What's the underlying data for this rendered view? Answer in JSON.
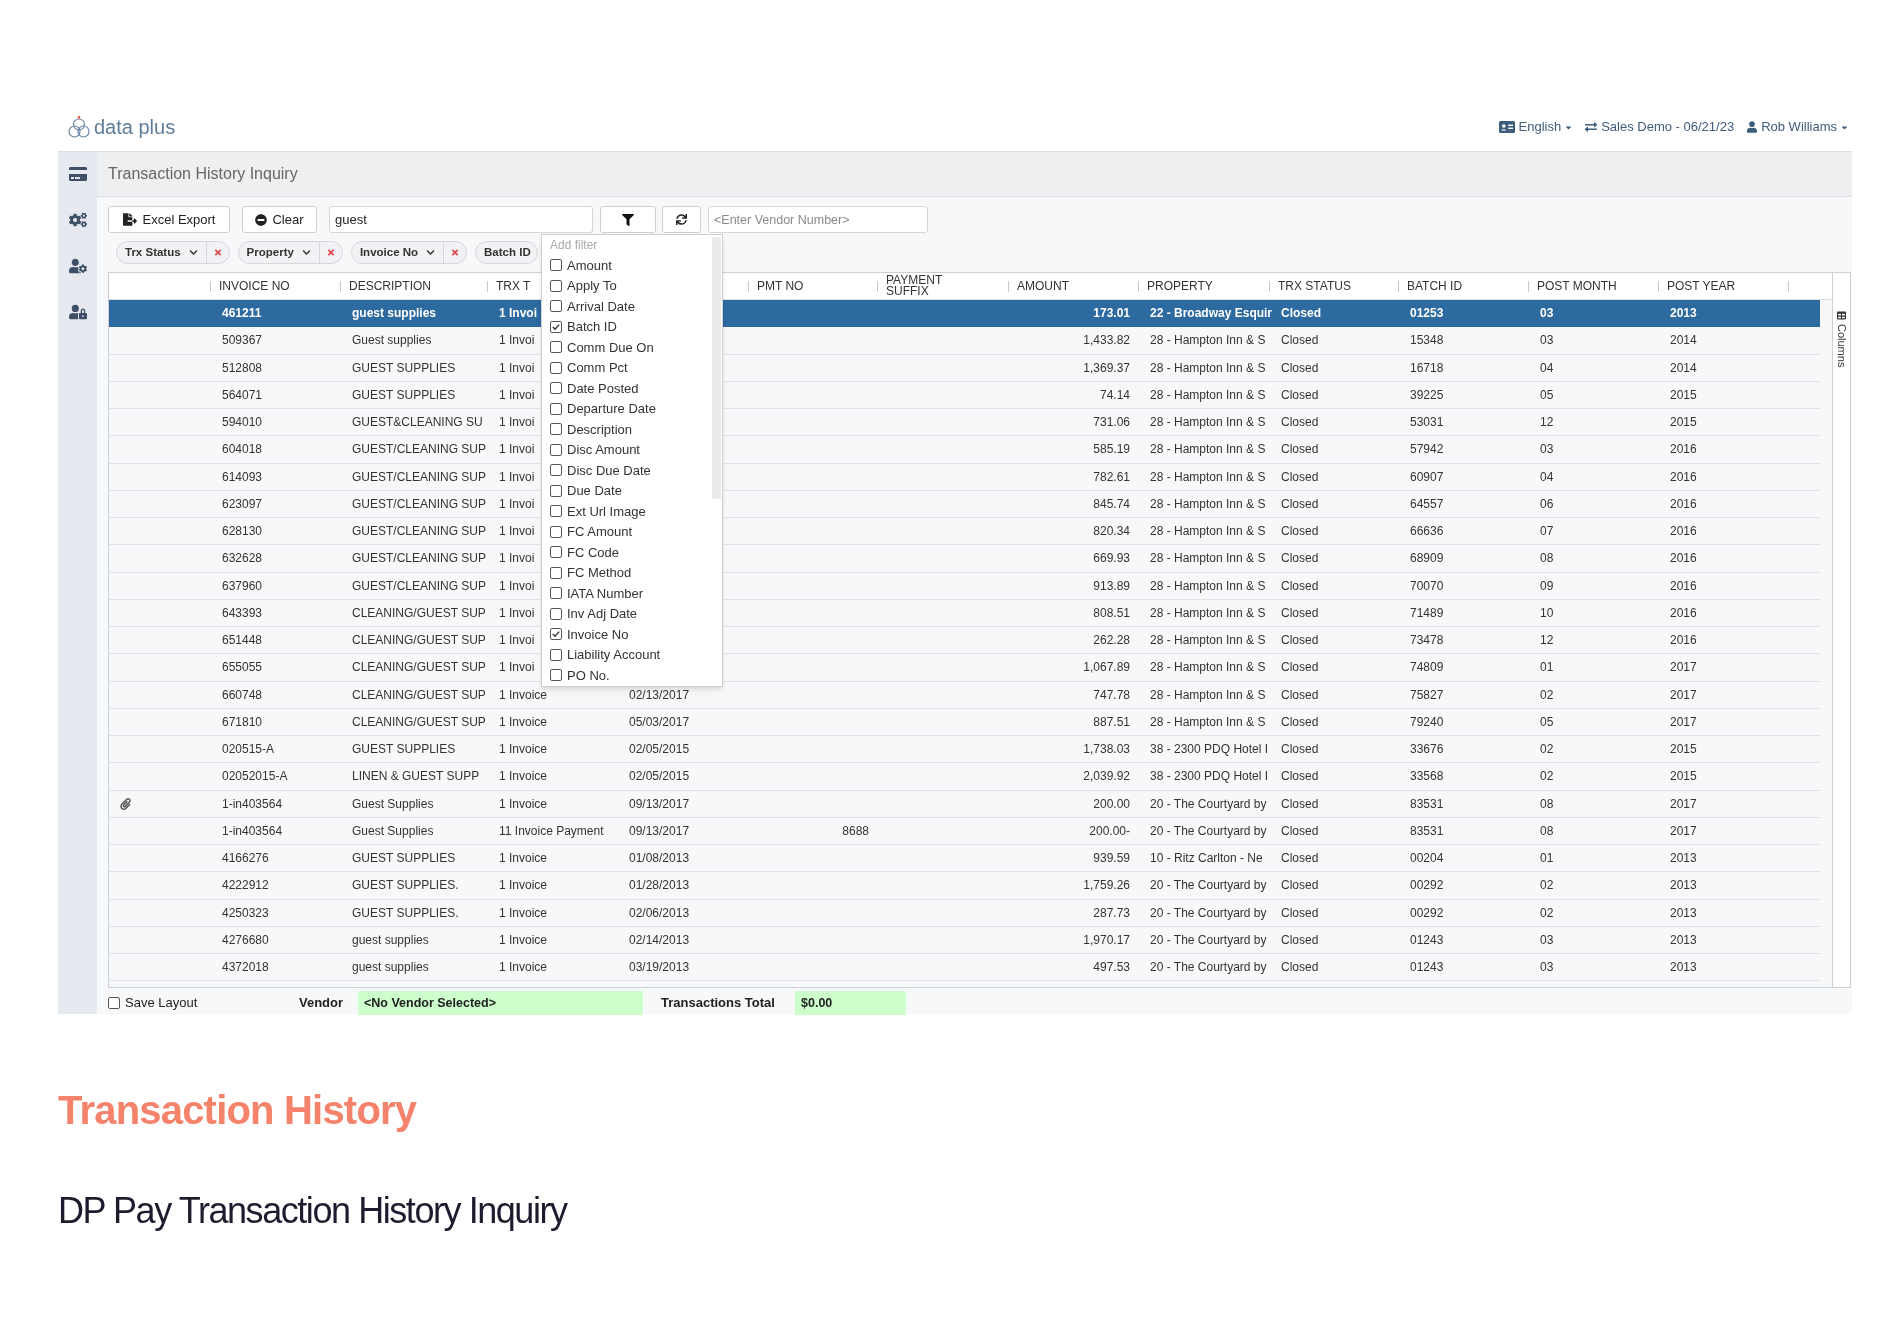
{
  "header": {
    "logo": "data plus",
    "language": "English",
    "session": "Sales Demo - 06/21/23",
    "user": "Rob Williams"
  },
  "page": {
    "title": "Transaction History Inquiry"
  },
  "toolbar": {
    "excel_export": "Excel Export",
    "clear": "Clear",
    "search": {
      "value": "guest"
    },
    "vendor_number": {
      "placeholder": "<Enter Vendor Number>"
    }
  },
  "filter_chips": [
    {
      "label": "Trx Status",
      "removable": true
    },
    {
      "label": "Property",
      "removable": true
    },
    {
      "label": "Invoice No",
      "removable": true
    },
    {
      "label": "Batch ID",
      "removable": false
    }
  ],
  "filter_menu": {
    "placeholder": "Add filter",
    "options": [
      {
        "label": "Amount",
        "checked": false
      },
      {
        "label": "Apply To",
        "checked": false
      },
      {
        "label": "Arrival Date",
        "checked": false
      },
      {
        "label": "Batch ID",
        "checked": true
      },
      {
        "label": "Comm Due On",
        "checked": false
      },
      {
        "label": "Comm Pct",
        "checked": false
      },
      {
        "label": "Date Posted",
        "checked": false
      },
      {
        "label": "Departure Date",
        "checked": false
      },
      {
        "label": "Description",
        "checked": false
      },
      {
        "label": "Disc Amount",
        "checked": false
      },
      {
        "label": "Disc Due Date",
        "checked": false
      },
      {
        "label": "Due Date",
        "checked": false
      },
      {
        "label": "Ext Url Image",
        "checked": false
      },
      {
        "label": "FC Amount",
        "checked": false
      },
      {
        "label": "FC Code",
        "checked": false
      },
      {
        "label": "FC Method",
        "checked": false
      },
      {
        "label": "IATA Number",
        "checked": false
      },
      {
        "label": "Inv Adj Date",
        "checked": false
      },
      {
        "label": "Invoice No",
        "checked": true
      },
      {
        "label": "Liability Account",
        "checked": false
      },
      {
        "label": "PO No.",
        "checked": false
      }
    ]
  },
  "table": {
    "columns": [
      "INVOICE NO",
      "DESCRIPTION",
      "TRX T",
      "PMT NO",
      "PAYMENT SUFFIX",
      "AMOUNT",
      "PROPERTY",
      "TRX STATUS",
      "BATCH ID",
      "POST MONTH",
      "POST YEAR"
    ],
    "rows": [
      {
        "selected": true,
        "attachment": false,
        "invoice_no": "461211",
        "description": "guest supplies",
        "column_3": "1 Invoi",
        "amount": "173.01",
        "property": "22 - Broadway Esquir",
        "trx_status": "Closed",
        "batch_id": "01253",
        "post_month": "03",
        "post_year": "2013"
      },
      {
        "selected": false,
        "attachment": false,
        "invoice_no": "509367",
        "description": "Guest supplies",
        "column_3": "1 Invoi",
        "amount": "1,433.82",
        "property": "28 - Hampton Inn & S",
        "trx_status": "Closed",
        "batch_id": "15348",
        "post_month": "03",
        "post_year": "2014"
      },
      {
        "selected": false,
        "attachment": false,
        "invoice_no": "512808",
        "description": "GUEST SUPPLIES",
        "column_3": "1 Invoi",
        "amount": "1,369.37",
        "property": "28 - Hampton Inn & S",
        "trx_status": "Closed",
        "batch_id": "16718",
        "post_month": "04",
        "post_year": "2014"
      },
      {
        "selected": false,
        "attachment": false,
        "invoice_no": "564071",
        "description": "GUEST SUPPLIES",
        "column_3": "1 Invoi",
        "amount": "74.14",
        "property": "28 - Hampton Inn & S",
        "trx_status": "Closed",
        "batch_id": "39225",
        "post_month": "05",
        "post_year": "2015"
      },
      {
        "selected": false,
        "attachment": false,
        "invoice_no": "594010",
        "description": "GUEST&CLEANING SU",
        "column_3": "1 Invoi",
        "amount": "731.06",
        "property": "28 - Hampton Inn & S",
        "trx_status": "Closed",
        "batch_id": "53031",
        "post_month": "12",
        "post_year": "2015"
      },
      {
        "selected": false,
        "attachment": false,
        "invoice_no": "604018",
        "description": "GUEST/CLEANING SUP",
        "column_3": "1 Invoi",
        "amount": "585.19",
        "property": "28 - Hampton Inn & S",
        "trx_status": "Closed",
        "batch_id": "57942",
        "post_month": "03",
        "post_year": "2016"
      },
      {
        "selected": false,
        "attachment": false,
        "invoice_no": "614093",
        "description": "GUEST/CLEANING SUP",
        "column_3": "1 Invoi",
        "amount": "782.61",
        "property": "28 - Hampton Inn & S",
        "trx_status": "Closed",
        "batch_id": "60907",
        "post_month": "04",
        "post_year": "2016"
      },
      {
        "selected": false,
        "attachment": false,
        "invoice_no": "623097",
        "description": "GUEST/CLEANING SUP",
        "column_3": "1 Invoi",
        "amount": "845.74",
        "property": "28 - Hampton Inn & S",
        "trx_status": "Closed",
        "batch_id": "64557",
        "post_month": "06",
        "post_year": "2016"
      },
      {
        "selected": false,
        "attachment": false,
        "invoice_no": "628130",
        "description": "GUEST/CLEANING SUP",
        "column_3": "1 Invoi",
        "amount": "820.34",
        "property": "28 - Hampton Inn & S",
        "trx_status": "Closed",
        "batch_id": "66636",
        "post_month": "07",
        "post_year": "2016"
      },
      {
        "selected": false,
        "attachment": false,
        "invoice_no": "632628",
        "description": "GUEST/CLEANING SUP",
        "column_3": "1 Invoi",
        "amount": "669.93",
        "property": "28 - Hampton Inn & S",
        "trx_status": "Closed",
        "batch_id": "68909",
        "post_month": "08",
        "post_year": "2016"
      },
      {
        "selected": false,
        "attachment": false,
        "invoice_no": "637960",
        "description": "GUEST/CLEANING SUP",
        "column_3": "1 Invoi",
        "amount": "913.89",
        "property": "28 - Hampton Inn & S",
        "trx_status": "Closed",
        "batch_id": "70070",
        "post_month": "09",
        "post_year": "2016"
      },
      {
        "selected": false,
        "attachment": false,
        "invoice_no": "643393",
        "description": "CLEANING/GUEST SUP",
        "column_3": "1 Invoi",
        "amount": "808.51",
        "property": "28 - Hampton Inn & S",
        "trx_status": "Closed",
        "batch_id": "71489",
        "post_month": "10",
        "post_year": "2016"
      },
      {
        "selected": false,
        "attachment": false,
        "invoice_no": "651448",
        "description": "CLEANING/GUEST SUP",
        "column_3": "1 Invoi",
        "amount": "262.28",
        "property": "28 - Hampton Inn & S",
        "trx_status": "Closed",
        "batch_id": "73478",
        "post_month": "12",
        "post_year": "2016"
      },
      {
        "selected": false,
        "attachment": false,
        "invoice_no": "655055",
        "description": "CLEANING/GUEST SUP",
        "column_3": "1 Invoi",
        "amount": "1,067.89",
        "property": "28 - Hampton Inn & S",
        "trx_status": "Closed",
        "batch_id": "74809",
        "post_month": "01",
        "post_year": "2017"
      },
      {
        "selected": false,
        "attachment": false,
        "invoice_no": "660748",
        "description": "CLEANING/GUEST SUP",
        "column_3": "1 Invoice",
        "column_4": "02/13/2017",
        "amount": "747.78",
        "property": "28 - Hampton Inn & S",
        "trx_status": "Closed",
        "batch_id": "75827",
        "post_month": "02",
        "post_year": "2017"
      },
      {
        "selected": false,
        "attachment": false,
        "invoice_no": "671810",
        "description": "CLEANING/GUEST SUP",
        "column_3": "1 Invoice",
        "column_4": "05/03/2017",
        "amount": "887.51",
        "property": "28 - Hampton Inn & S",
        "trx_status": "Closed",
        "batch_id": "79240",
        "post_month": "05",
        "post_year": "2017"
      },
      {
        "selected": false,
        "attachment": false,
        "invoice_no": "020515-A",
        "description": "GUEST SUPPLIES",
        "column_3": "1 Invoice",
        "column_4": "02/05/2015",
        "amount": "1,738.03",
        "property": "38 - 2300 PDQ Hotel I",
        "trx_status": "Closed",
        "batch_id": "33676",
        "post_month": "02",
        "post_year": "2015"
      },
      {
        "selected": false,
        "attachment": false,
        "invoice_no": "02052015-A",
        "description": "LINEN & GUEST SUPP",
        "column_3": "1 Invoice",
        "column_4": "02/05/2015",
        "amount": "2,039.92",
        "property": "38 - 2300 PDQ Hotel I",
        "trx_status": "Closed",
        "batch_id": "33568",
        "post_month": "02",
        "post_year": "2015"
      },
      {
        "selected": false,
        "attachment": true,
        "invoice_no": "1-in403564",
        "description": "Guest Supplies",
        "column_3": "1 Invoice",
        "column_4": "09/13/2017",
        "amount": "200.00",
        "property": "20 - The Courtyard by",
        "trx_status": "Closed",
        "batch_id": "83531",
        "post_month": "08",
        "post_year": "2017"
      },
      {
        "selected": false,
        "attachment": false,
        "invoice_no": "1-in403564",
        "description": "Guest Supplies",
        "column_3": "11 Invoice Payment",
        "column_4": "09/13/2017",
        "pmt_no": "8688",
        "amount": "200.00-",
        "property": "20 - The Courtyard by",
        "trx_status": "Closed",
        "batch_id": "83531",
        "post_month": "08",
        "post_year": "2017"
      },
      {
        "selected": false,
        "attachment": false,
        "invoice_no": "4166276",
        "description": "GUEST SUPPLIES",
        "column_3": "1 Invoice",
        "column_4": "01/08/2013",
        "amount": "939.59",
        "property": "10 - Ritz Carlton - Ne",
        "trx_status": "Closed",
        "batch_id": "00204",
        "post_month": "01",
        "post_year": "2013"
      },
      {
        "selected": false,
        "attachment": false,
        "invoice_no": "4222912",
        "description": "GUEST SUPPLIES.",
        "column_3": "1 Invoice",
        "column_4": "01/28/2013",
        "amount": "1,759.26",
        "property": "20 - The Courtyard by",
        "trx_status": "Closed",
        "batch_id": "00292",
        "post_month": "02",
        "post_year": "2013"
      },
      {
        "selected": false,
        "attachment": false,
        "invoice_no": "4250323",
        "description": "GUEST SUPPLIES.",
        "column_3": "1 Invoice",
        "column_4": "02/06/2013",
        "amount": "287.73",
        "property": "20 - The Courtyard by",
        "trx_status": "Closed",
        "batch_id": "00292",
        "post_month": "02",
        "post_year": "2013"
      },
      {
        "selected": false,
        "attachment": false,
        "invoice_no": "4276680",
        "description": "guest supplies",
        "column_3": "1 Invoice",
        "column_4": "02/14/2013",
        "amount": "1,970.17",
        "property": "20 - The Courtyard by",
        "trx_status": "Closed",
        "batch_id": "01243",
        "post_month": "03",
        "post_year": "2013"
      },
      {
        "selected": false,
        "attachment": false,
        "invoice_no": "4372018",
        "description": "guest supplies",
        "column_3": "1 Invoice",
        "column_4": "03/19/2013",
        "amount": "497.53",
        "property": "20 - The Courtyard by",
        "trx_status": "Closed",
        "batch_id": "01243",
        "post_month": "03",
        "post_year": "2013"
      }
    ]
  },
  "columns_panel": {
    "label": "Columns"
  },
  "footer": {
    "save_layout": {
      "label": "Save Layout",
      "checked": false
    },
    "vendor": {
      "label": "Vendor",
      "value": "<No Vendor Selected>"
    },
    "transactions_total": {
      "label": "Transactions Total",
      "value": "$0.00"
    }
  },
  "caption": {
    "title": "Transaction History",
    "subtitle": "DP Pay Transaction History Inquiry"
  }
}
